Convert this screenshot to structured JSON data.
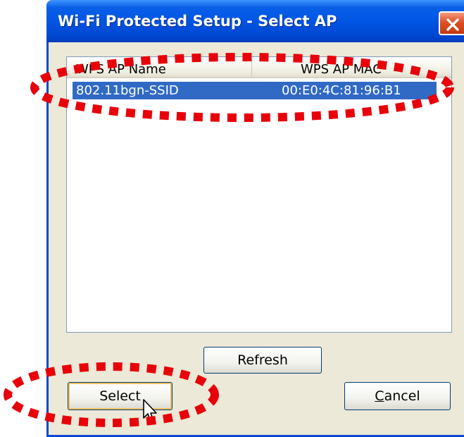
{
  "window": {
    "title": "Wi-Fi Protected Setup - Select AP",
    "close_icon": "close-icon"
  },
  "ap_list": {
    "columns": [
      "WPS AP Name",
      "WPS AP MAC"
    ],
    "rows": [
      {
        "name": "802.11bgn-SSID",
        "mac": "00:E0:4C:81:96:B1",
        "selected": true
      }
    ]
  },
  "buttons": {
    "refresh": "Refresh",
    "select": "Select",
    "cancel_rest": "ancel",
    "cancel_accel": "C"
  },
  "annotations": {
    "style": "red-dotted-ellipse",
    "color": "#e8000a"
  },
  "colors": {
    "titlebar": "#0055e5",
    "selection": "#316ac5",
    "dialog_bg": "#ece9d8"
  }
}
